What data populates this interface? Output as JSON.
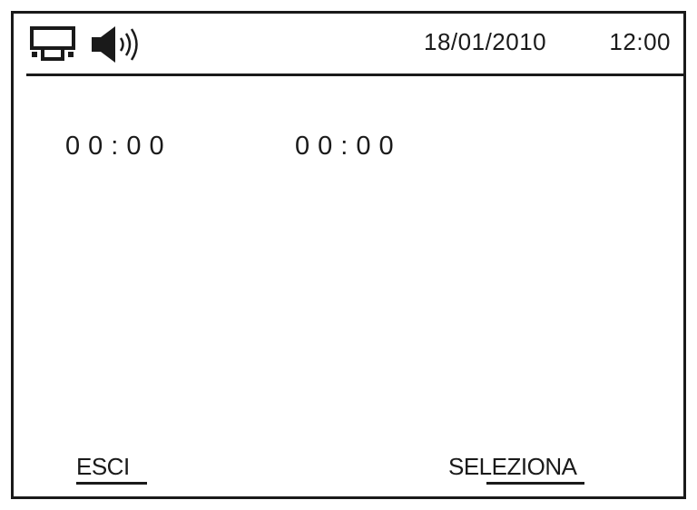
{
  "status_bar": {
    "network_icon": "network-icon",
    "speaker_icon": "speaker-volume-icon",
    "date": "18/01/2010",
    "time": "12:00"
  },
  "timers": [
    {
      "value": "00:00"
    },
    {
      "value": "00:00"
    }
  ],
  "softkeys": {
    "exit_label": "ESCI",
    "select_label": "SELEZIONA"
  },
  "colors": {
    "foreground": "#1a1a1a",
    "background": "#ffffff"
  }
}
